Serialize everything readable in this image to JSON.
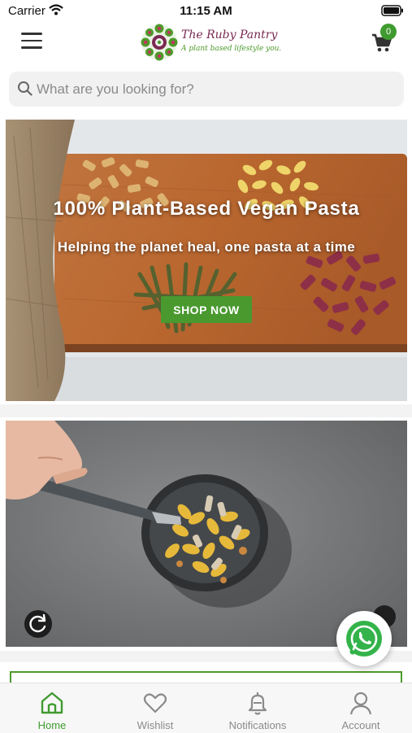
{
  "status_bar": {
    "carrier": "Carrier",
    "time": "11:15 AM",
    "icons": [
      "wifi-icon",
      "battery-icon"
    ]
  },
  "header": {
    "menu_icon": "hamburger-icon",
    "logo": {
      "name": "The Ruby Pantry",
      "tagline": "A plant based lifestyle you."
    },
    "cart": {
      "icon": "cart-icon",
      "count": "0"
    }
  },
  "search": {
    "placeholder": "What are you looking for?",
    "value": ""
  },
  "hero": {
    "title": "100% Plant-Based Vegan Pasta",
    "subtitle": "Helping the planet heal, one pasta at a time",
    "button_label": "SHOP NOW"
  },
  "video": {
    "replay_icon": "replay-icon"
  },
  "floating": {
    "whatsapp_icon": "whatsapp-icon"
  },
  "tabs": [
    {
      "label": "Home",
      "icon": "home-icon",
      "active": true
    },
    {
      "label": "Wishlist",
      "icon": "heart-icon",
      "active": false
    },
    {
      "label": "Notifications",
      "icon": "bell-icon",
      "active": false
    },
    {
      "label": "Account",
      "icon": "user-icon",
      "active": false
    }
  ],
  "colors": {
    "accent": "#3f9b2f",
    "brand_maroon": "#7a2a52",
    "search_bg": "#f1f1f1",
    "inactive": "#8a8a8a"
  }
}
